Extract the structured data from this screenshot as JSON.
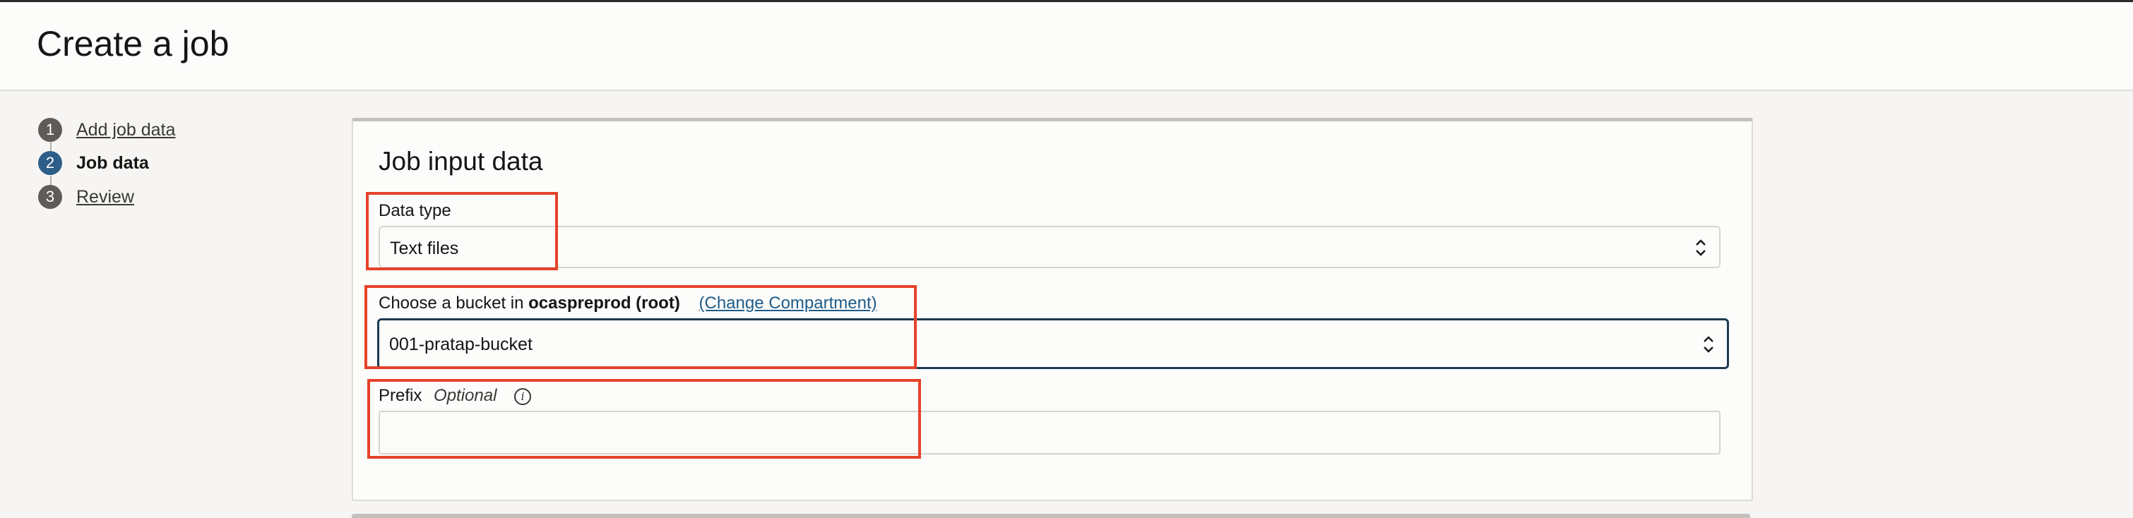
{
  "header": {
    "title": "Create a job"
  },
  "steps": [
    {
      "number": "1",
      "label": "Add job data"
    },
    {
      "number": "2",
      "label": "Job data"
    },
    {
      "number": "3",
      "label": "Review"
    }
  ],
  "panel": {
    "title": "Job input data",
    "data_type": {
      "label": "Data type",
      "value": "Text files"
    },
    "bucket": {
      "label_prefix": "Choose a bucket in",
      "compartment": "ocaspreprod (root)",
      "change_link": "(Change Compartment)",
      "value": "001-pratap-bucket"
    },
    "prefix": {
      "label": "Prefix",
      "optional": "Optional",
      "value": ""
    }
  },
  "colors": {
    "highlight": "#e5432a",
    "active_step": "#2c5e87",
    "link": "#1f5c89"
  }
}
